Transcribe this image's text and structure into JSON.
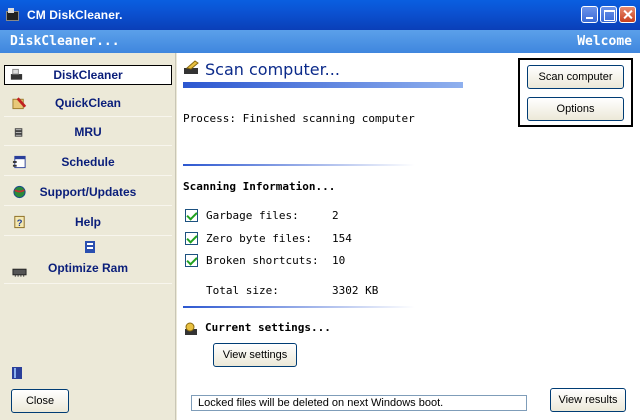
{
  "window": {
    "title": "CM DiskCleaner.",
    "icon": "disk-cleaner-icon",
    "controls": [
      "minimize",
      "maximize",
      "close"
    ]
  },
  "header": {
    "left": "DiskCleaner...",
    "right": "Welcome"
  },
  "sidebar": {
    "items": [
      {
        "label": "DiskCleaner",
        "icon": "broom-icon",
        "active": true
      },
      {
        "label": "QuickClean",
        "icon": "quickclean-icon"
      },
      {
        "label": "MRU",
        "icon": "list-icon"
      },
      {
        "label": "Schedule",
        "icon": "schedule-icon"
      },
      {
        "label": "Support/Updates",
        "icon": "globe-icon"
      },
      {
        "label": "Help",
        "icon": "help-icon"
      },
      {
        "label": "Optimize Ram",
        "icon": "ram-chip-icon"
      }
    ],
    "close_label": "Close"
  },
  "main": {
    "title": "Scan computer...",
    "process_text": "Process: Finished scanning computer",
    "scan_info_heading": "Scanning Information...",
    "rows": [
      {
        "label": "Garbage files:",
        "value": "2",
        "checked": true
      },
      {
        "label": "Zero byte files:",
        "value": "154",
        "checked": true
      },
      {
        "label": "Broken shortcuts:",
        "value": "10",
        "checked": true
      }
    ],
    "total_label": "Total size:",
    "total_value": "3302 KB",
    "settings_heading": "Current settings...",
    "view_settings_label": "View settings",
    "scan_button_label": "Scan computer",
    "options_button_label": "Options",
    "status_text": "Locked files will be deleted on next Windows boot.",
    "view_results_label": "View results"
  }
}
